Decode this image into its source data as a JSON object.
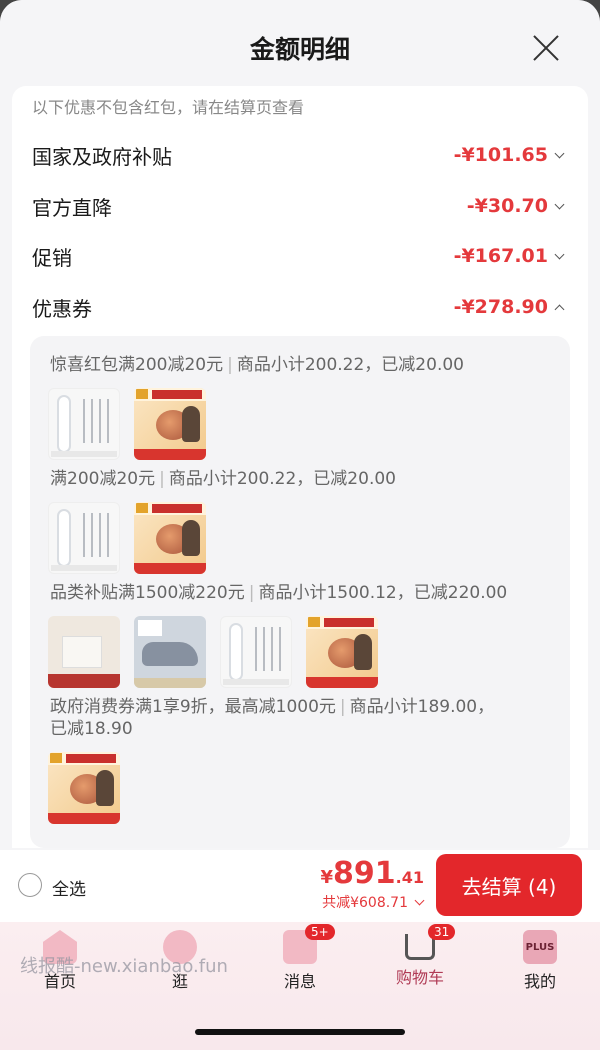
{
  "header": {
    "title": "金额明细"
  },
  "note": "以下优惠不包含红包，请在结算页查看",
  "discount_rows": [
    {
      "label": "国家及政府补贴",
      "amount": "-¥101.65"
    },
    {
      "label": "官方直降",
      "amount": "-¥30.70"
    },
    {
      "label": "促销",
      "amount": "-¥167.01"
    },
    {
      "label": "优惠券",
      "amount": "-¥278.90"
    }
  ],
  "coupons": [
    {
      "name": "惊喜红包满200减20元",
      "detail": "商品小计200.22，已减20.00"
    },
    {
      "name": "满200减20元",
      "detail": "商品小计200.22，已减20.00"
    },
    {
      "name": "品类补贴满1500减220元",
      "detail": "商品小计1500.12，已减220.00"
    },
    {
      "name": "政府消费券满1享9折，最高减1000元",
      "detail": "商品小计189.00，",
      "detail2": "已减18.90"
    }
  ],
  "bottom_bar": {
    "select_all": "全选",
    "total_yen": "¥",
    "total_int": "891",
    "total_dec": ".41",
    "saved": "共减¥608.71",
    "checkout": "去结算 (4)"
  },
  "tabbar": {
    "home": "首页",
    "browse": "逛",
    "messages": "消息",
    "messages_badge": "5+",
    "cart": "购物车",
    "cart_badge": "31",
    "mine": "我的",
    "mine_icon_text": "PLUS",
    "watermark": "线报酷-new.xianbao.fun"
  },
  "colors": {
    "accent": "#e4393c",
    "checkout_bg": "#e3272b"
  }
}
